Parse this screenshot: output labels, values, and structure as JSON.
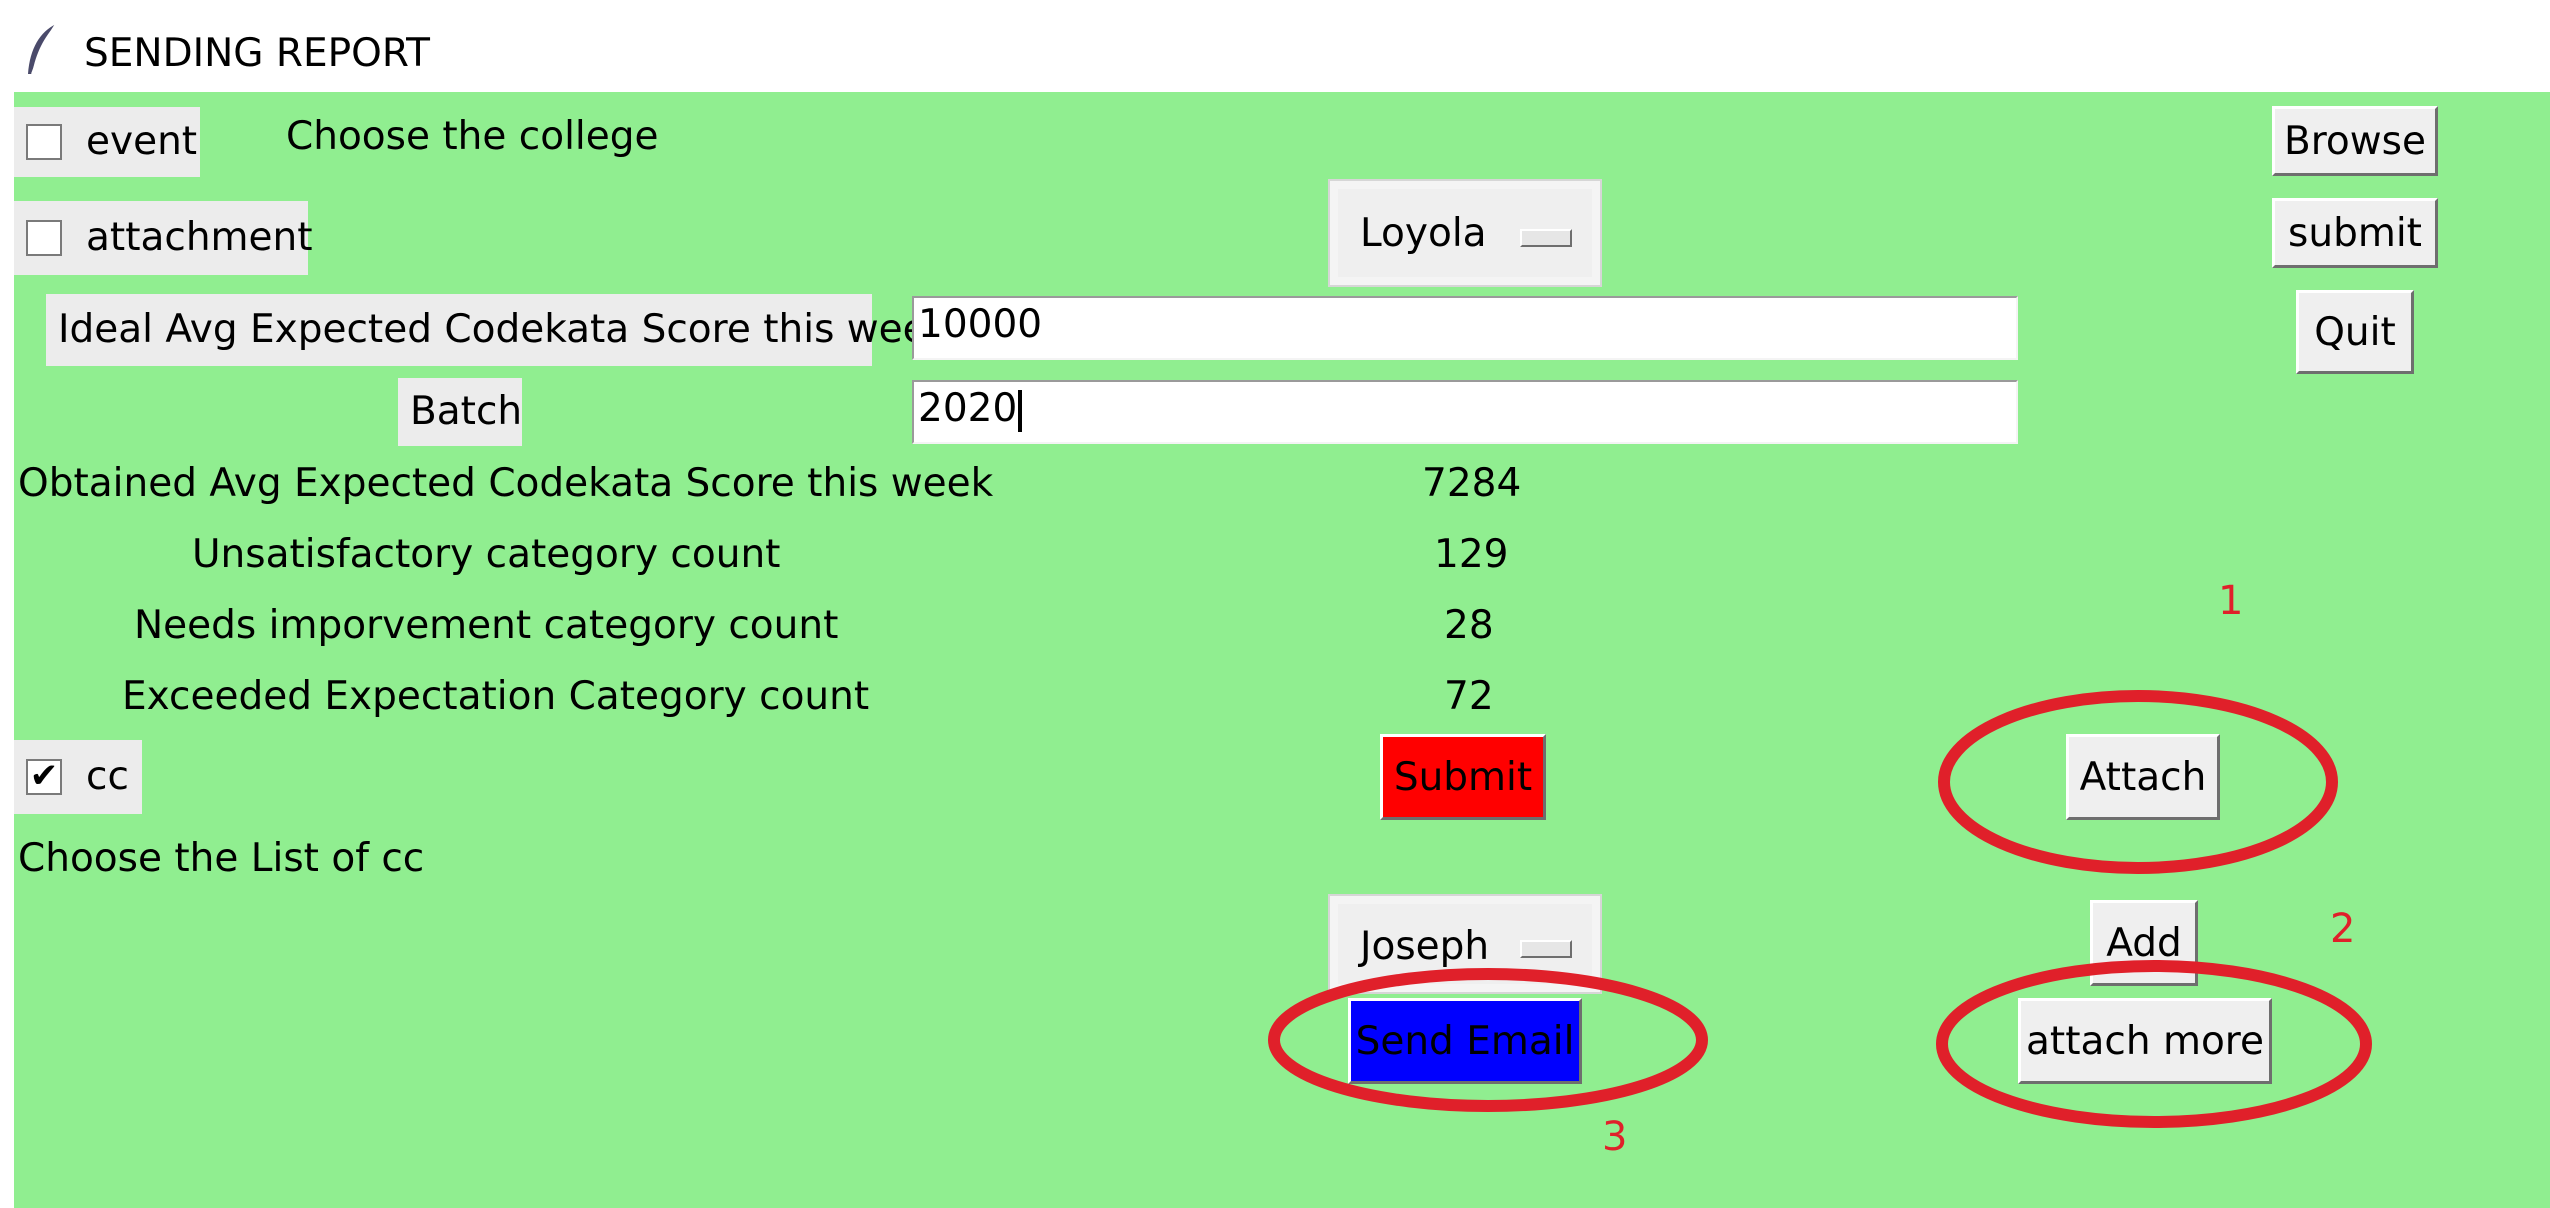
{
  "window": {
    "title": "SENDING REPORT",
    "icon": "feather-icon"
  },
  "checkboxes": {
    "event": {
      "label": "event",
      "checked": false
    },
    "attachment": {
      "label": "attachment",
      "checked": false
    },
    "cc": {
      "label": "cc",
      "checked": true,
      "mark": "✔"
    }
  },
  "college": {
    "prompt": "Choose the college",
    "selected": "Loyola"
  },
  "buttons": {
    "browse": "Browse",
    "submit_top": "submit",
    "quit": "Quit",
    "submit_red": "Submit",
    "attach": "Attach",
    "add": "Add",
    "send_email": "Send Email",
    "attach_more": "attach more"
  },
  "fields": {
    "ideal_label": "Ideal Avg Expected Codekata Score this week",
    "ideal_value": "10000",
    "batch_label": "Batch",
    "batch_value": "2020"
  },
  "stats": [
    {
      "label": "Obtained Avg Expected Codekata Score this week",
      "value": "7284"
    },
    {
      "label": "Unsatisfactory category count",
      "value": "129"
    },
    {
      "label": "Needs imporvement category count",
      "value": "28"
    },
    {
      "label": "Exceeded Expectation Category count",
      "value": "72"
    }
  ],
  "cc_list": {
    "prompt": "Choose the List of cc",
    "selected": "Joseph"
  },
  "annotations": {
    "n1": "1",
    "n2": "2",
    "n3": "3",
    "color": "#e0202a"
  },
  "colors": {
    "background": "#90ee90",
    "submit_red": "#ff0000",
    "send_email_blue": "#0000ff"
  }
}
